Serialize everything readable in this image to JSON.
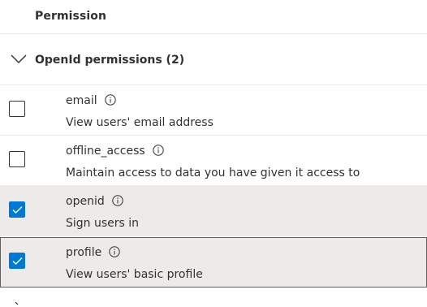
{
  "header": {
    "column_label": "Permission"
  },
  "group": {
    "label": "OpenId permissions (2)",
    "expanded": true
  },
  "permissions": [
    {
      "name": "email",
      "description": "View users' email address",
      "checked": false
    },
    {
      "name": "offline_access",
      "description": "Maintain access to data you have given it access to",
      "checked": false
    },
    {
      "name": "openid",
      "description": "Sign users in",
      "checked": true
    },
    {
      "name": "profile",
      "description": "View users' basic profile",
      "checked": true
    }
  ],
  "colors": {
    "accent": "#0078d4",
    "selected_bg": "#edebe9",
    "text": "#323130",
    "divider": "#edebe9"
  }
}
